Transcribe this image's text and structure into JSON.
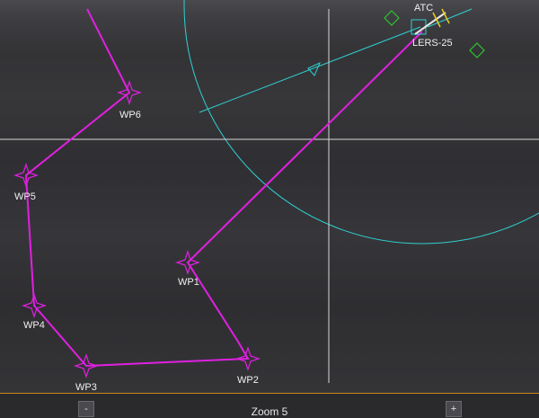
{
  "map": {
    "route_color": "#e020e0",
    "range_ring_color": "#30d0d0",
    "crosshair_color": "#d8d8d8",
    "waypoint_icon": "four-point-star-icon",
    "waypoints": [
      {
        "id": "wp6",
        "label": "WP6"
      },
      {
        "id": "wp5",
        "label": "WP5"
      },
      {
        "id": "wp4",
        "label": "WP4"
      },
      {
        "id": "wp3",
        "label": "WP3"
      },
      {
        "id": "wp2",
        "label": "WP2"
      },
      {
        "id": "wp1",
        "label": "WP1"
      }
    ],
    "airport": {
      "label": "LERS-25",
      "partial_label": "ATC",
      "icon": "runway-square-icon"
    },
    "markers": {
      "ndb_icon": "green-diamond-icon",
      "ndb_color": "#2ec42e"
    }
  },
  "bottom_bar": {
    "zoom_label": "Zoom 5",
    "zoom_out_label": "-",
    "zoom_in_label": "+",
    "accent_color": "#c88a1a"
  }
}
